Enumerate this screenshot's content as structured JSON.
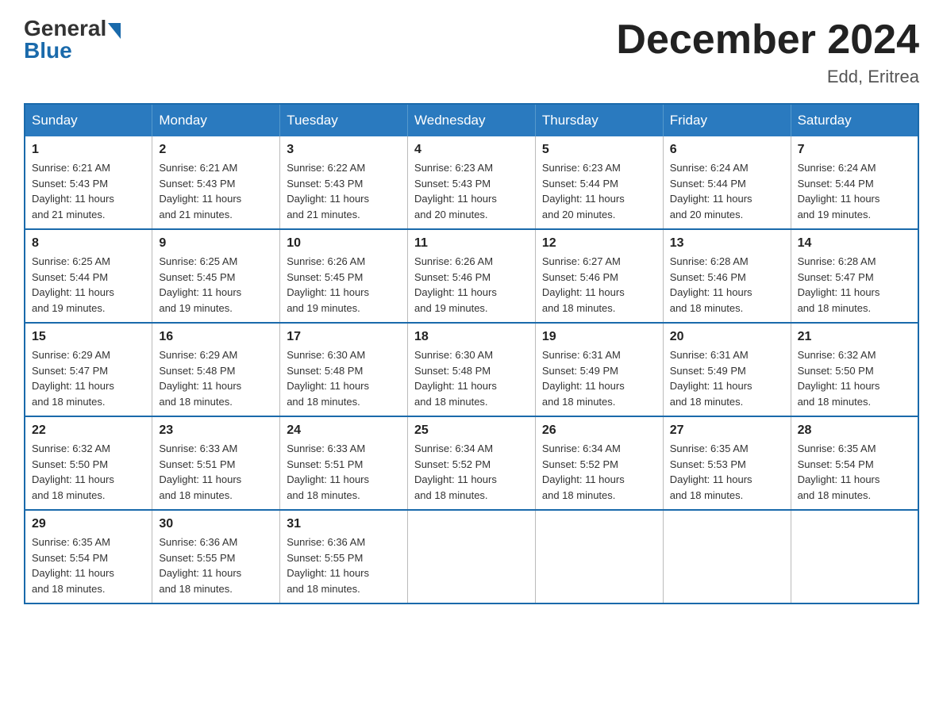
{
  "header": {
    "logo_general": "General",
    "logo_blue": "Blue",
    "month_title": "December 2024",
    "location": "Edd, Eritrea"
  },
  "weekdays": [
    "Sunday",
    "Monday",
    "Tuesday",
    "Wednesday",
    "Thursday",
    "Friday",
    "Saturday"
  ],
  "weeks": [
    [
      {
        "day": "1",
        "sunrise": "6:21 AM",
        "sunset": "5:43 PM",
        "daylight": "11 hours and 21 minutes."
      },
      {
        "day": "2",
        "sunrise": "6:21 AM",
        "sunset": "5:43 PM",
        "daylight": "11 hours and 21 minutes."
      },
      {
        "day": "3",
        "sunrise": "6:22 AM",
        "sunset": "5:43 PM",
        "daylight": "11 hours and 21 minutes."
      },
      {
        "day": "4",
        "sunrise": "6:23 AM",
        "sunset": "5:43 PM",
        "daylight": "11 hours and 20 minutes."
      },
      {
        "day": "5",
        "sunrise": "6:23 AM",
        "sunset": "5:44 PM",
        "daylight": "11 hours and 20 minutes."
      },
      {
        "day": "6",
        "sunrise": "6:24 AM",
        "sunset": "5:44 PM",
        "daylight": "11 hours and 20 minutes."
      },
      {
        "day": "7",
        "sunrise": "6:24 AM",
        "sunset": "5:44 PM",
        "daylight": "11 hours and 19 minutes."
      }
    ],
    [
      {
        "day": "8",
        "sunrise": "6:25 AM",
        "sunset": "5:44 PM",
        "daylight": "11 hours and 19 minutes."
      },
      {
        "day": "9",
        "sunrise": "6:25 AM",
        "sunset": "5:45 PM",
        "daylight": "11 hours and 19 minutes."
      },
      {
        "day": "10",
        "sunrise": "6:26 AM",
        "sunset": "5:45 PM",
        "daylight": "11 hours and 19 minutes."
      },
      {
        "day": "11",
        "sunrise": "6:26 AM",
        "sunset": "5:46 PM",
        "daylight": "11 hours and 19 minutes."
      },
      {
        "day": "12",
        "sunrise": "6:27 AM",
        "sunset": "5:46 PM",
        "daylight": "11 hours and 18 minutes."
      },
      {
        "day": "13",
        "sunrise": "6:28 AM",
        "sunset": "5:46 PM",
        "daylight": "11 hours and 18 minutes."
      },
      {
        "day": "14",
        "sunrise": "6:28 AM",
        "sunset": "5:47 PM",
        "daylight": "11 hours and 18 minutes."
      }
    ],
    [
      {
        "day": "15",
        "sunrise": "6:29 AM",
        "sunset": "5:47 PM",
        "daylight": "11 hours and 18 minutes."
      },
      {
        "day": "16",
        "sunrise": "6:29 AM",
        "sunset": "5:48 PM",
        "daylight": "11 hours and 18 minutes."
      },
      {
        "day": "17",
        "sunrise": "6:30 AM",
        "sunset": "5:48 PM",
        "daylight": "11 hours and 18 minutes."
      },
      {
        "day": "18",
        "sunrise": "6:30 AM",
        "sunset": "5:48 PM",
        "daylight": "11 hours and 18 minutes."
      },
      {
        "day": "19",
        "sunrise": "6:31 AM",
        "sunset": "5:49 PM",
        "daylight": "11 hours and 18 minutes."
      },
      {
        "day": "20",
        "sunrise": "6:31 AM",
        "sunset": "5:49 PM",
        "daylight": "11 hours and 18 minutes."
      },
      {
        "day": "21",
        "sunrise": "6:32 AM",
        "sunset": "5:50 PM",
        "daylight": "11 hours and 18 minutes."
      }
    ],
    [
      {
        "day": "22",
        "sunrise": "6:32 AM",
        "sunset": "5:50 PM",
        "daylight": "11 hours and 18 minutes."
      },
      {
        "day": "23",
        "sunrise": "6:33 AM",
        "sunset": "5:51 PM",
        "daylight": "11 hours and 18 minutes."
      },
      {
        "day": "24",
        "sunrise": "6:33 AM",
        "sunset": "5:51 PM",
        "daylight": "11 hours and 18 minutes."
      },
      {
        "day": "25",
        "sunrise": "6:34 AM",
        "sunset": "5:52 PM",
        "daylight": "11 hours and 18 minutes."
      },
      {
        "day": "26",
        "sunrise": "6:34 AM",
        "sunset": "5:52 PM",
        "daylight": "11 hours and 18 minutes."
      },
      {
        "day": "27",
        "sunrise": "6:35 AM",
        "sunset": "5:53 PM",
        "daylight": "11 hours and 18 minutes."
      },
      {
        "day": "28",
        "sunrise": "6:35 AM",
        "sunset": "5:54 PM",
        "daylight": "11 hours and 18 minutes."
      }
    ],
    [
      {
        "day": "29",
        "sunrise": "6:35 AM",
        "sunset": "5:54 PM",
        "daylight": "11 hours and 18 minutes."
      },
      {
        "day": "30",
        "sunrise": "6:36 AM",
        "sunset": "5:55 PM",
        "daylight": "11 hours and 18 minutes."
      },
      {
        "day": "31",
        "sunrise": "6:36 AM",
        "sunset": "5:55 PM",
        "daylight": "11 hours and 18 minutes."
      },
      null,
      null,
      null,
      null
    ]
  ],
  "labels": {
    "sunrise": "Sunrise:",
    "sunset": "Sunset:",
    "daylight": "Daylight:"
  }
}
